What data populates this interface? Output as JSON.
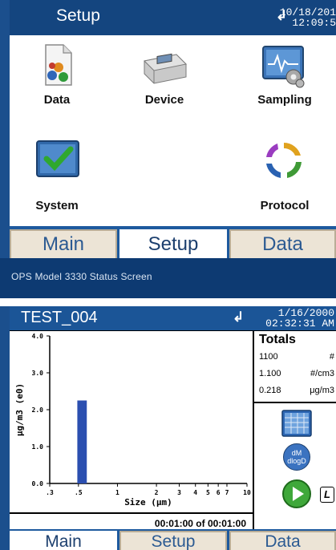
{
  "setup_screen": {
    "title": "Setup",
    "date": "10/18/201",
    "time": "12:09:5",
    "apps": [
      {
        "label": "Data",
        "icon": "data-icon"
      },
      {
        "label": "Device",
        "icon": "device-icon"
      },
      {
        "label": "Sampling",
        "icon": "sampling-icon"
      },
      {
        "label": "System",
        "icon": "system-icon"
      },
      {
        "label": "Protocol",
        "icon": "protocol-icon"
      }
    ],
    "tabs": [
      {
        "label": "Main",
        "active": false
      },
      {
        "label": "Setup",
        "active": true
      },
      {
        "label": "Data",
        "active": false
      }
    ]
  },
  "caption": "OPS Model 3330 Status Screen",
  "status_screen": {
    "title": "TEST_004",
    "date": "1/16/2000",
    "time": "02:32:31 AM",
    "totals": {
      "heading": "Totals",
      "rows": [
        {
          "value": "1100",
          "unit": "#"
        },
        {
          "value": "1.100",
          "unit": "#/cm3"
        },
        {
          "value": "0.218",
          "unit": "μg/m3"
        }
      ]
    },
    "counter": "00:01:00 of 00:01:00",
    "buttons": {
      "dm_top": "dM",
      "dm_bottom": "dlogD",
      "log_label": "L"
    },
    "tabs": [
      {
        "label": "Main",
        "active": true
      },
      {
        "label": "Setup",
        "active": false
      },
      {
        "label": "Data",
        "active": false
      }
    ]
  },
  "chart_data": {
    "type": "bar",
    "xlabel": "Size (μm)",
    "ylabel": "μg/m3 (e0)",
    "xscale": "log",
    "xlim": [
      0.3,
      10
    ],
    "ylim": [
      0.0,
      4.0
    ],
    "xticks": [
      {
        "v": 0.3,
        "label": ".3"
      },
      {
        "v": 0.5,
        "label": ".5"
      },
      {
        "v": 1,
        "label": "1"
      },
      {
        "v": 2,
        "label": "2"
      },
      {
        "v": 3,
        "label": "3"
      },
      {
        "v": 4,
        "label": "4"
      },
      {
        "v": 5,
        "label": "5"
      },
      {
        "v": 6,
        "label": "6"
      },
      {
        "v": 7,
        "label": "7"
      },
      {
        "v": 10,
        "label": "10"
      }
    ],
    "yticks": [
      {
        "v": 0.0,
        "label": "0.0"
      },
      {
        "v": 1.0,
        "label": "1.0"
      },
      {
        "v": 2.0,
        "label": "2.0"
      },
      {
        "v": 3.0,
        "label": "3.0"
      },
      {
        "v": 4.0,
        "label": "4.0"
      }
    ],
    "bars": [
      {
        "x0": 0.49,
        "x1": 0.58,
        "value": 2.25
      }
    ],
    "bar_color": "#2b4fb0",
    "grid": false
  }
}
